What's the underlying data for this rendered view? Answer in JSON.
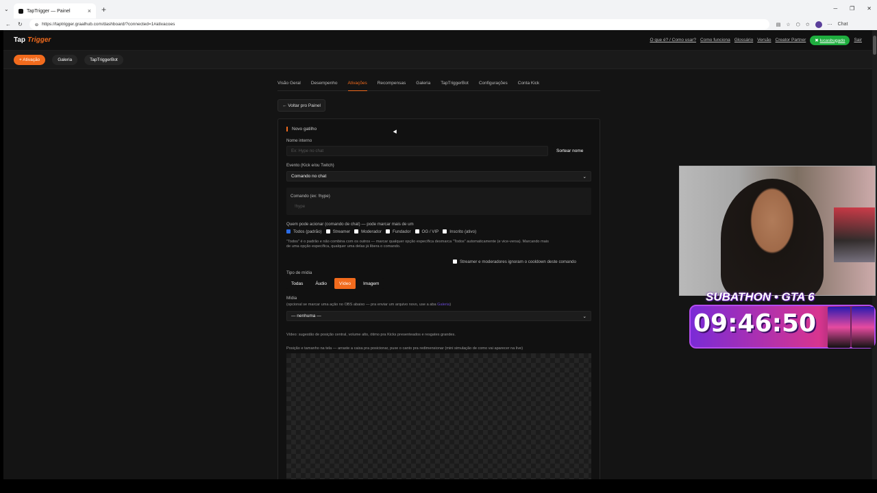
{
  "browser": {
    "tab_title": "TapTrigger — Painel",
    "url": "https://taptrigger.graalhub.com/dashboard/?connected=1#ativacoes",
    "chat_label": "Chat"
  },
  "header": {
    "logo_main": "Tap",
    "logo_accent": "Trigger",
    "links": [
      "O que é? / Como usar?",
      "Como funciona",
      "Glossário",
      "Versão",
      "Creator Partner"
    ],
    "user": "lucasbugado",
    "logout": "Sair"
  },
  "subnav": {
    "activation": "+ Ativação",
    "gallery": "Galeria",
    "bot": "TapTriggerBot"
  },
  "tabs": [
    "Visão Geral",
    "Desempenho",
    "Ativações",
    "Recompensas",
    "Galeria",
    "TapTriggerBot",
    "Configurações",
    "Conta Kick"
  ],
  "back": "← Voltar pro Painel",
  "form": {
    "title": "Novo gatilho",
    "name_label": "Nome interno",
    "name_placeholder": "Ex: Hype no chat",
    "random_name": "Sortear nome",
    "event_label": "Evento (Kick e/ou Twitch)",
    "event_value": "Comando no chat",
    "command_label": "Comando (ex: !hype)",
    "command_placeholder": "!hype",
    "who_label": "Quem pode acionar (comando de chat) — pode marcar mais de um",
    "roles": [
      {
        "label": "Todos (padrão)",
        "checked": true
      },
      {
        "label": "Streamer",
        "checked": false
      },
      {
        "label": "Moderador",
        "checked": false
      },
      {
        "label": "Fundador",
        "checked": false
      },
      {
        "label": "OG / VIP",
        "checked": false
      },
      {
        "label": "Inscrito (ativo)",
        "checked": false
      }
    ],
    "roles_help_1": "\"Todos\" é o padrão e não combina com os outros — marcar qualquer opção específica desmarca \"Todos\" automaticamente (e vice-versa). Marcando mais",
    "roles_help_2": "de uma opção específica, qualquer uma delas já libera o comando.",
    "cooldown_label": "Streamer e moderadores ignoram o cooldown deste comando",
    "media_type_label": "Tipo de mídia",
    "media_types": [
      "Todas",
      "Áudio",
      "Vídeo",
      "Imagem"
    ],
    "media_active": "Vídeo",
    "media_label": "Mídia",
    "media_help": "(opcional se marcar uma ação no OBS abaixo — pra enviar um arquivo novo, use a aba",
    "media_help_link": "Galeria",
    "media_help_end": ")",
    "media_value": "— nenhuma —",
    "video_hint": "Vídeo: sugestão de posição central, volume alto, ótimo pra Kicks presenteados e resgates grandes.",
    "position_hint": "Posição e tamanho na tela — arraste a caixa pra posicionar, puxe o canto pra redimensionar (mini simulação de como vai aparecer na live)"
  },
  "overlay": {
    "title": "SUBATHON • GTA 6",
    "timer": "09:46:50"
  },
  "colors": {
    "accent": "#f26b1d",
    "success": "#1fae3f",
    "background": "#141414"
  }
}
